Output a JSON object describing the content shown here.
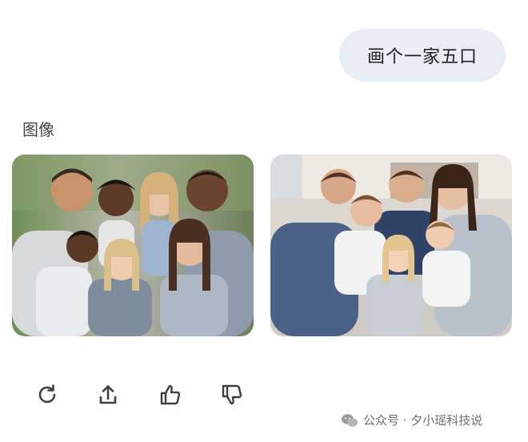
{
  "user_message": {
    "text": "画个一家五口"
  },
  "response": {
    "section_label": "图像",
    "images": [
      {
        "alt": "family photo outdoors"
      },
      {
        "alt": "family photo on sofa"
      }
    ]
  },
  "actions": {
    "items": [
      {
        "icon": "refresh-icon"
      },
      {
        "icon": "share-icon"
      },
      {
        "icon": "thumbs-up-icon"
      },
      {
        "icon": "thumbs-down-icon"
      }
    ]
  },
  "watermark": {
    "text": "公众号 · 夕小瑶科技说",
    "icon": "wechat-icon"
  }
}
